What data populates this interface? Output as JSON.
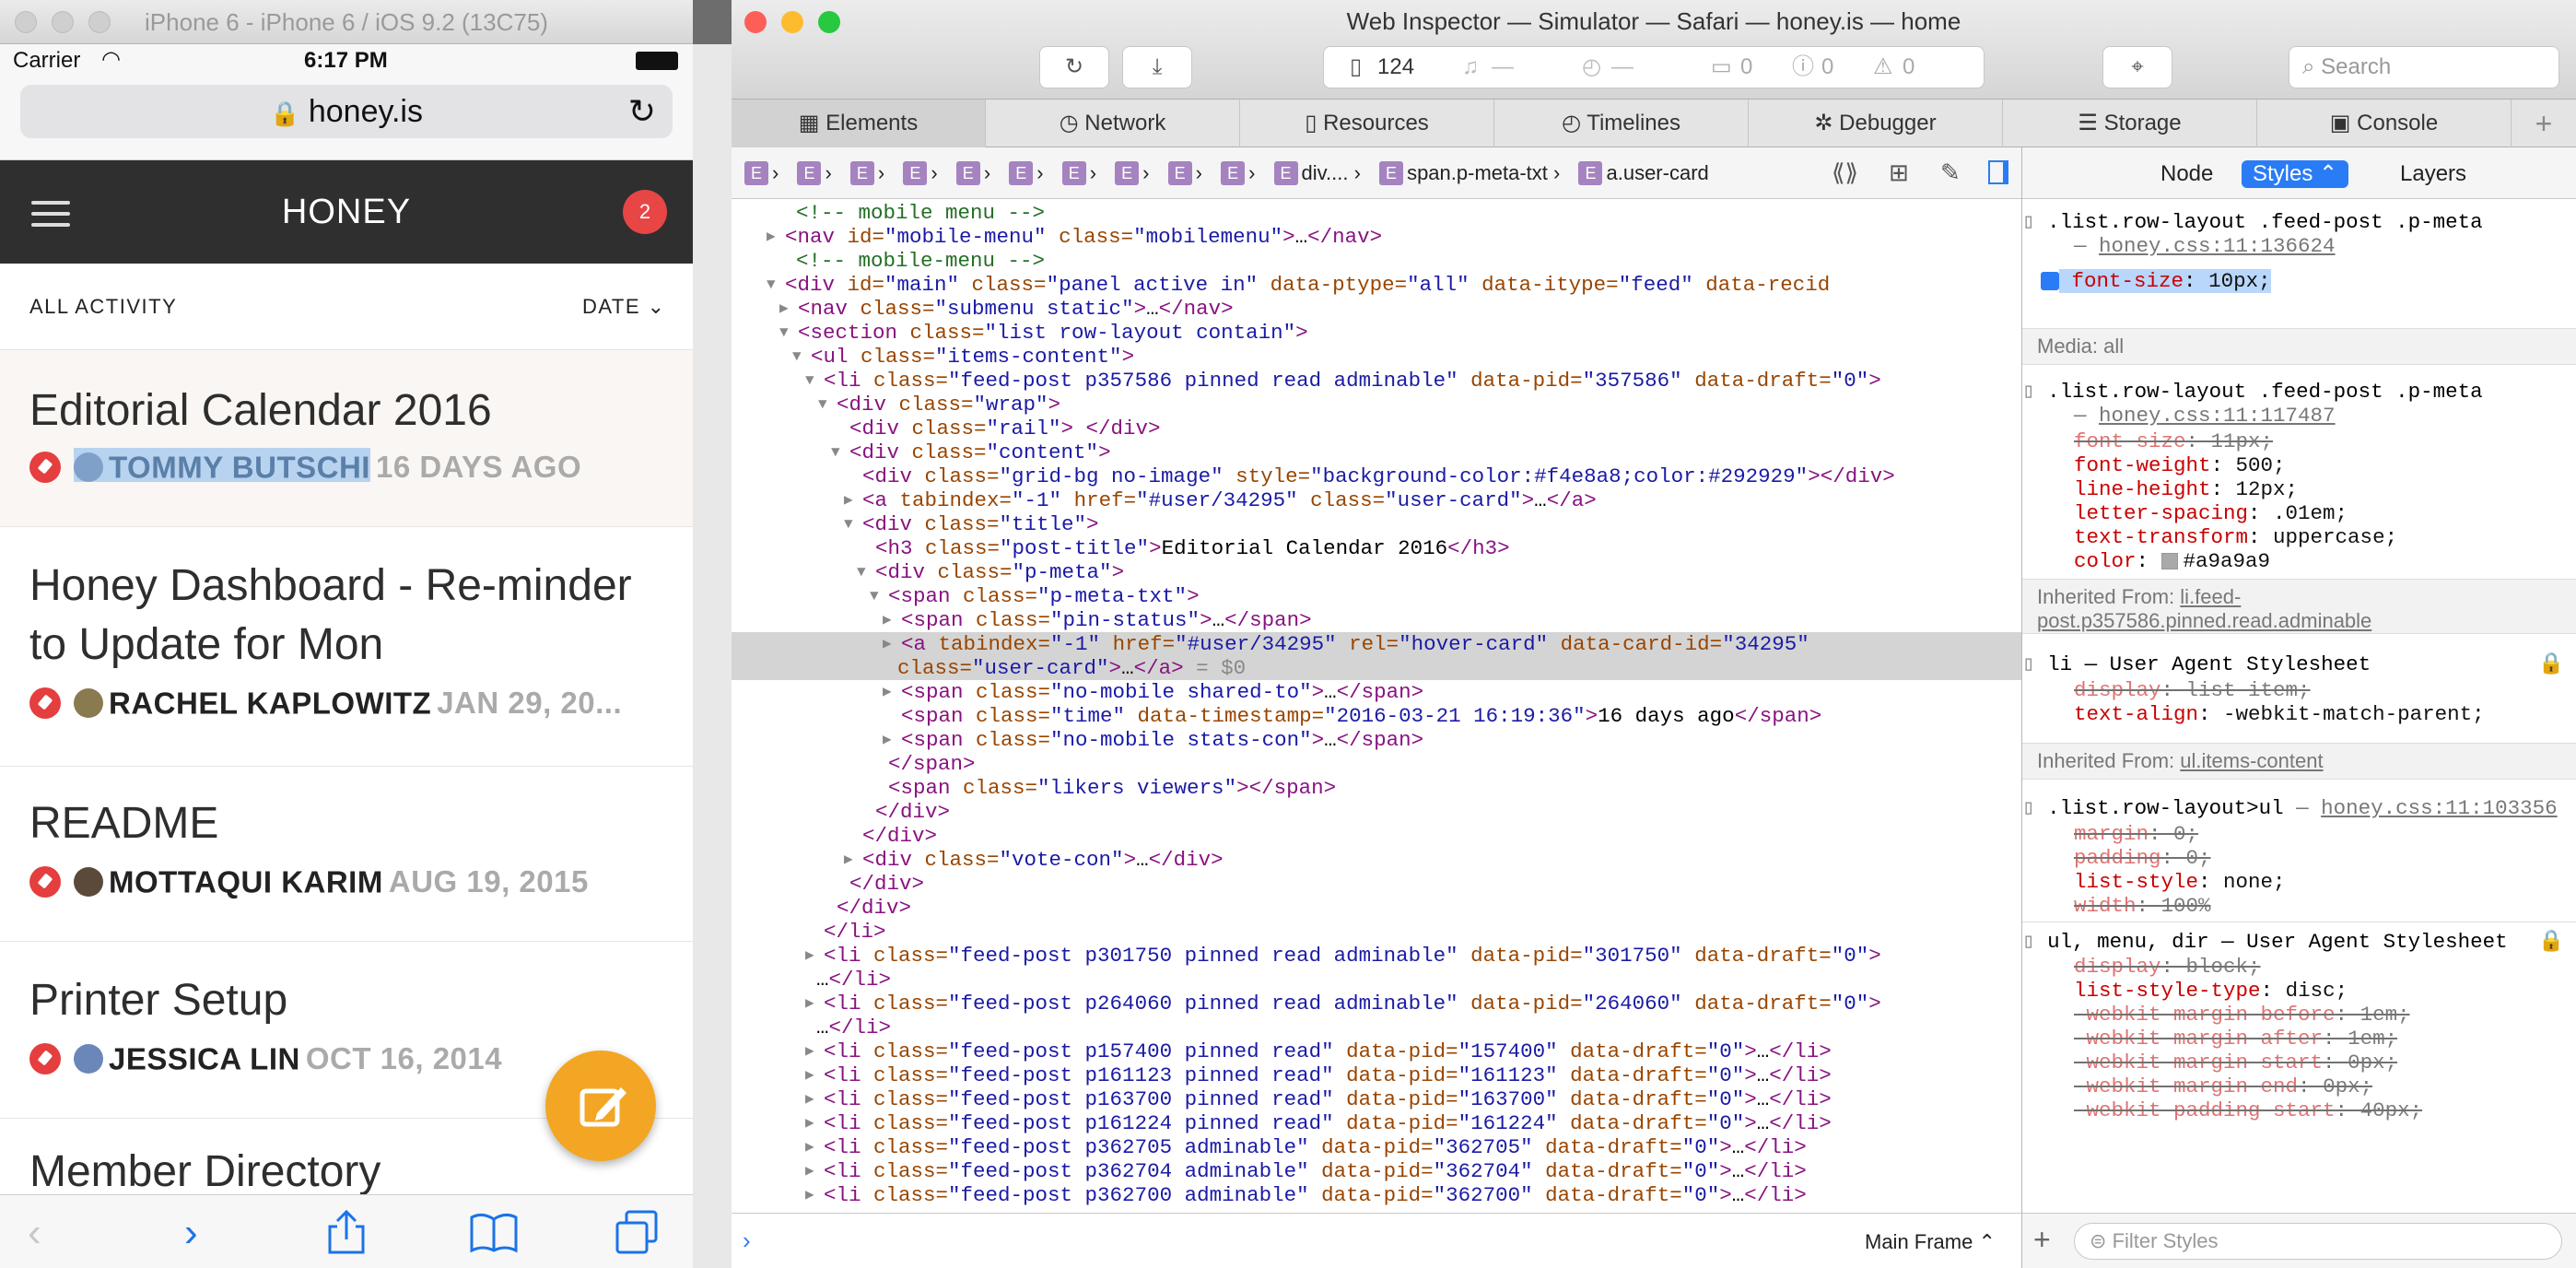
{
  "simulator": {
    "title": "iPhone 6 - iPhone 6 / iOS 9.2 (13C75)",
    "carrier": "Carrier",
    "time": "6:17 PM",
    "url": "honey.is",
    "app_title": "HONEY",
    "badge": "2",
    "filter_left": "ALL ACTIVITY",
    "filter_right": "DATE",
    "feed": [
      {
        "title": "Editorial Calendar 2016",
        "author": "TOMMY BUTSCHI",
        "date": "16 DAYS AGO"
      },
      {
        "title": "Honey Dashboard - Re-minder to Update for Mon",
        "author": "RACHEL KAPLOWITZ",
        "date": "JAN 29, 20..."
      },
      {
        "title": "README",
        "author": "MOTTAQUI KARIM",
        "date": "AUG 19, 2015"
      },
      {
        "title": "Printer Setup",
        "author": "JESSICA LIN",
        "date": "OCT 16, 2014"
      },
      {
        "title": "Member Directory",
        "author": "",
        "date": ""
      }
    ]
  },
  "inspector": {
    "title": "Web Inspector — Simulator — Safari — honey.is — home",
    "resource_count": "124",
    "dash1": "—",
    "dash2": "—",
    "msg0": "0",
    "err0": "0",
    "warn0": "0",
    "search_placeholder": "Search",
    "tabs": [
      "Elements",
      "Network",
      "Resources",
      "Timelines",
      "Debugger",
      "Storage",
      "Console"
    ],
    "breadcrumbs": [
      "div....",
      "span.p-meta-txt",
      "a.user-card"
    ],
    "crumb_letter": "E",
    "dom_lines": [
      [
        "cm",
        "<!-- mobile menu -->"
      ],
      [
        "tg",
        "<nav ",
        "an",
        "id=",
        "av",
        "\"mobile-menu\" ",
        "an",
        "class=",
        "av",
        "\"mobilemenu\"",
        "tg",
        ">",
        "tx",
        "…",
        "tg",
        "</nav>"
      ],
      [
        "cm",
        "<!-- mobile-menu -->"
      ],
      [
        "tg",
        "<div ",
        "an",
        "id=",
        "av",
        "\"main\" ",
        "an",
        "class=",
        "av",
        "\"panel active in\" ",
        "an",
        "data-ptype=",
        "av",
        "\"all\" ",
        "an",
        "data-itype=",
        "av",
        "\"feed\" ",
        "an",
        "data-recid"
      ],
      [
        "tg",
        "<nav ",
        "an",
        "class=",
        "av",
        "\"submenu static\"",
        "tg",
        ">",
        "tx",
        "…",
        "tg",
        "</nav>"
      ],
      [
        "tg",
        "<section ",
        "an",
        "class=",
        "av",
        "\"list row-layout contain\"",
        "tg",
        ">"
      ],
      [
        "tg",
        "<ul ",
        "an",
        "class=",
        "av",
        "\"items-content\"",
        "tg",
        ">"
      ],
      [
        "tg",
        "<li ",
        "an",
        "class=",
        "av",
        "\"feed-post p357586 pinned read adminable\" ",
        "an",
        "data-pid=",
        "av",
        "\"357586\" ",
        "an",
        "data-draft=",
        "av",
        "\"0\"",
        "tg",
        ">"
      ],
      [
        "tg",
        "<div ",
        "an",
        "class=",
        "av",
        "\"wrap\"",
        "tg",
        ">"
      ],
      [
        "tg",
        "<div ",
        "an",
        "class=",
        "av",
        "\"rail\"",
        "tg",
        "> </div>"
      ],
      [
        "tg",
        "<div ",
        "an",
        "class=",
        "av",
        "\"content\"",
        "tg",
        ">"
      ],
      [
        "tg",
        "<div ",
        "an",
        "class=",
        "av",
        "\"grid-bg no-image\" ",
        "an",
        "style=",
        "av",
        "\"background-color:#f4e8a8;color:#292929\"",
        "tg",
        "></div>"
      ],
      [
        "tg",
        "<a ",
        "an",
        "tabindex=",
        "av",
        "\"-1\" ",
        "an",
        "href=",
        "av",
        "\"#user/34295\" ",
        "an",
        "class=",
        "av",
        "\"user-card\"",
        "tg",
        ">",
        "tx",
        "…",
        "tg",
        "</a>"
      ],
      [
        "tg",
        "<div ",
        "an",
        "class=",
        "av",
        "\"title\"",
        "tg",
        ">"
      ],
      [
        "tg",
        "<h3 ",
        "an",
        "class=",
        "av",
        "\"post-title\"",
        "tg",
        ">",
        "tx",
        "Editorial Calendar 2016",
        "tg",
        "</h3>"
      ],
      [
        "tg",
        "<div ",
        "an",
        "class=",
        "av",
        "\"p-meta\"",
        "tg",
        ">"
      ],
      [
        "tg",
        "<span ",
        "an",
        "class=",
        "av",
        "\"p-meta-txt\"",
        "tg",
        ">"
      ],
      [
        "tg",
        "<span ",
        "an",
        "class=",
        "av",
        "\"pin-status\"",
        "tg",
        ">",
        "tx",
        "…",
        "tg",
        "</span>"
      ],
      [
        "tg",
        "<a ",
        "an",
        "tabindex=",
        "av",
        "\"-1\" ",
        "an",
        "href=",
        "av",
        "\"#user/34295\" ",
        "an",
        "rel=",
        "av",
        "\"hover-card\" ",
        "an",
        "data-card-id=",
        "av",
        "\"34295\""
      ],
      [
        "an",
        "class=",
        "av",
        "\"user-card\"",
        "tg",
        ">",
        "tx",
        "…",
        "tg",
        "</a>",
        "hv",
        " = $0"
      ],
      [
        "tg",
        "<span ",
        "an",
        "class=",
        "av",
        "\"no-mobile shared-to\"",
        "tg",
        ">",
        "tx",
        "…",
        "tg",
        "</span>"
      ],
      [
        "tg",
        "<span ",
        "an",
        "class=",
        "av",
        "\"time\" ",
        "an",
        "data-timestamp=",
        "av",
        "\"2016-03-21 16:19:36\"",
        "tg",
        ">",
        "tx",
        "16 days ago",
        "tg",
        "</span>"
      ],
      [
        "tg",
        "<span ",
        "an",
        "class=",
        "av",
        "\"no-mobile stats-con\"",
        "tg",
        ">",
        "tx",
        "…",
        "tg",
        "</span>"
      ],
      [
        "tg",
        "</span>"
      ],
      [
        "tg",
        "<span ",
        "an",
        "class=",
        "av",
        "\"likers viewers\"",
        "tg",
        "></span>"
      ],
      [
        "tg",
        "</div>"
      ],
      [
        "tg",
        "</div>"
      ],
      [
        "tg",
        "<div ",
        "an",
        "class=",
        "av",
        "\"vote-con\"",
        "tg",
        ">",
        "tx",
        "…",
        "tg",
        "</div>"
      ],
      [
        "tg",
        "</div>"
      ],
      [
        "tg",
        "</div>"
      ],
      [
        "tg",
        "</li>"
      ],
      [
        "tg",
        "<li ",
        "an",
        "class=",
        "av",
        "\"feed-post p301750 pinned read adminable\" ",
        "an",
        "data-pid=",
        "av",
        "\"301750\" ",
        "an",
        "data-draft=",
        "av",
        "\"0\"",
        "tg",
        ">"
      ],
      [
        "tx",
        "…",
        "tg",
        "</li>"
      ],
      [
        "tg",
        "<li ",
        "an",
        "class=",
        "av",
        "\"feed-post p264060 pinned read adminable\" ",
        "an",
        "data-pid=",
        "av",
        "\"264060\" ",
        "an",
        "data-draft=",
        "av",
        "\"0\"",
        "tg",
        ">"
      ],
      [
        "tx",
        "…",
        "tg",
        "</li>"
      ],
      [
        "tg",
        "<li ",
        "an",
        "class=",
        "av",
        "\"feed-post p157400 pinned read\" ",
        "an",
        "data-pid=",
        "av",
        "\"157400\" ",
        "an",
        "data-draft=",
        "av",
        "\"0\"",
        "tg",
        ">",
        "tx",
        "…",
        "tg",
        "</li>"
      ],
      [
        "tg",
        "<li ",
        "an",
        "class=",
        "av",
        "\"feed-post p161123 pinned read\" ",
        "an",
        "data-pid=",
        "av",
        "\"161123\" ",
        "an",
        "data-draft=",
        "av",
        "\"0\"",
        "tg",
        ">",
        "tx",
        "…",
        "tg",
        "</li>"
      ],
      [
        "tg",
        "<li ",
        "an",
        "class=",
        "av",
        "\"feed-post p163700 pinned read\" ",
        "an",
        "data-pid=",
        "av",
        "\"163700\" ",
        "an",
        "data-draft=",
        "av",
        "\"0\"",
        "tg",
        ">",
        "tx",
        "…",
        "tg",
        "</li>"
      ],
      [
        "tg",
        "<li ",
        "an",
        "class=",
        "av",
        "\"feed-post p161224 pinned read\" ",
        "an",
        "data-pid=",
        "av",
        "\"161224\" ",
        "an",
        "data-draft=",
        "av",
        "\"0\"",
        "tg",
        ">",
        "tx",
        "…",
        "tg",
        "</li>"
      ],
      [
        "tg",
        "<li ",
        "an",
        "class=",
        "av",
        "\"feed-post p362705 adminable\" ",
        "an",
        "data-pid=",
        "av",
        "\"362705\" ",
        "an",
        "data-draft=",
        "av",
        "\"0\"",
        "tg",
        ">",
        "tx",
        "…",
        "tg",
        "</li>"
      ],
      [
        "tg",
        "<li ",
        "an",
        "class=",
        "av",
        "\"feed-post p362704 adminable\" ",
        "an",
        "data-pid=",
        "av",
        "\"362704\" ",
        "an",
        "data-draft=",
        "av",
        "\"0\"",
        "tg",
        ">",
        "tx",
        "…",
        "tg",
        "</li>"
      ],
      [
        "tg",
        "<li ",
        "an",
        "class=",
        "av",
        "\"feed-post p362700 adminable\" ",
        "an",
        "data-pid=",
        "av",
        "\"362700\" ",
        "an",
        "data-draft=",
        "av",
        "\"0\"",
        "tg",
        ">",
        "tx",
        "…",
        "tg",
        "</li>"
      ]
    ],
    "sidebar_tabs": [
      "Node",
      "Styles",
      "Layers"
    ],
    "styles": {
      "rule1_selector": ".list.row-layout .feed-post .p-meta",
      "rule1_source": "honey.css:11:136624",
      "rule1_prop": "font-size",
      "rule1_val": "10px;",
      "media": "Media: all",
      "rule2_selector": ".list.row-layout .feed-post .p-meta",
      "rule2_source": "honey.css:11:117487",
      "rule2_props": [
        [
          "font-size",
          "11px;"
        ],
        [
          "font-weight",
          "500;"
        ],
        [
          "line-height",
          "12px;"
        ],
        [
          "letter-spacing",
          ".01em;"
        ],
        [
          "text-transform",
          "uppercase;"
        ],
        [
          "color",
          "#a9a9a9"
        ]
      ],
      "inherited1_label": "Inherited From:",
      "inherited1_link": "li.feed-post.p357586.pinned.read.adminable",
      "ua_rule1": "li — User Agent Stylesheet",
      "ua1_props": [
        [
          "display",
          "list-item;"
        ],
        [
          "text-align",
          "-webkit-match-parent;"
        ]
      ],
      "inherited2_label": "Inherited From:",
      "inherited2_link": "ul.items-content",
      "rule3_selector": ".list.row-layout>ul",
      "rule3_source": "honey.css:11:103356",
      "rule3_props": [
        [
          "margin",
          "0;"
        ],
        [
          "padding",
          "0;"
        ],
        [
          "list-style",
          "none;"
        ],
        [
          "width",
          "100%"
        ]
      ],
      "ua_rule2": "ul, menu, dir — User Agent Stylesheet",
      "ua2_props": [
        [
          "display",
          "block;"
        ],
        [
          "list-style-type",
          "disc;"
        ],
        [
          "-webkit-margin-before",
          "1em;"
        ],
        [
          "-webkit-margin-after",
          "1em;"
        ],
        [
          "-webkit-margin-start",
          "0px;"
        ],
        [
          "-webkit-margin-end",
          "0px;"
        ],
        [
          "-webkit-padding-start",
          "40px;"
        ]
      ],
      "filter_placeholder": "Filter Styles"
    },
    "frame": "Main Frame"
  },
  "colors": {
    "accent": "#2a7cf6",
    "pin": "#e53e3e",
    "fab": "#f3a623",
    "badge": "#e84545"
  }
}
